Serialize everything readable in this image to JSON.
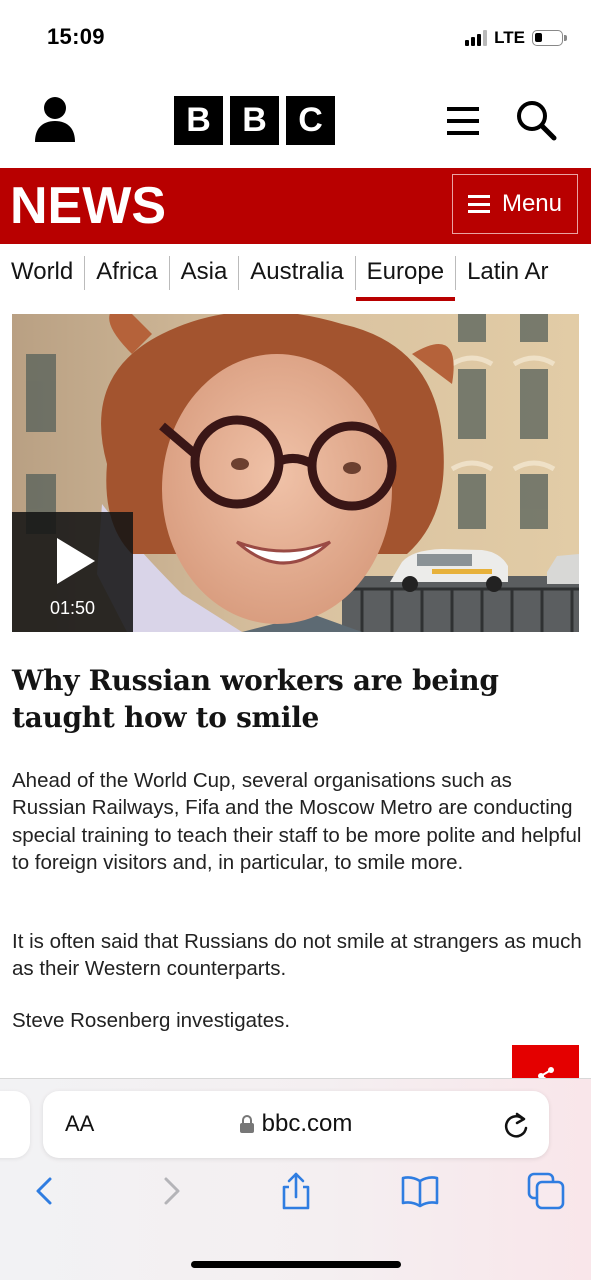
{
  "status_bar": {
    "time": "15:09",
    "network": "LTE"
  },
  "header": {
    "logo_letters": [
      "B",
      "B",
      "C"
    ],
    "icons": [
      "account-icon",
      "hamburger-icon",
      "search-icon"
    ]
  },
  "news_bar": {
    "title": "NEWS",
    "menu_label": "Menu",
    "brand_color": "#b80000"
  },
  "nav": {
    "items": [
      "World",
      "Africa",
      "Asia",
      "Australia",
      "Europe",
      "Latin Ar"
    ],
    "active": "Europe"
  },
  "video": {
    "duration": "01:50"
  },
  "article": {
    "headline": "Why Russian workers are being taught how to smile",
    "paragraphs": [
      "Ahead of the World Cup, several organisations such as Russian Railways, Fifa and the Moscow Metro are conducting special training to teach their staff to be more polite and helpful to foreign visitors and, in particular, to smile more.",
      "It is often said that Russians do not smile at strangers as much as their Western counterparts.",
      "Steve Rosenberg investigates."
    ]
  },
  "browser": {
    "text_size_label": "AA",
    "url": "bbc.com",
    "toolbar_icons": [
      "back-icon",
      "forward-icon",
      "share-icon",
      "bookmarks-icon",
      "tabs-icon"
    ]
  }
}
